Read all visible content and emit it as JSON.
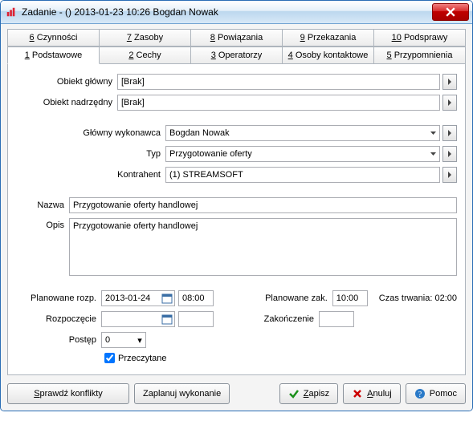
{
  "window": {
    "title": "Zadanie - ()  2013-01-23 10:26  Bogdan Nowak"
  },
  "tabs_top": [
    {
      "key": "6",
      "label": "Czynności"
    },
    {
      "key": "7",
      "label": "Zasoby"
    },
    {
      "key": "8",
      "label": "Powiązania"
    },
    {
      "key": "9",
      "label": "Przekazania"
    },
    {
      "key": "10",
      "label": "Podsprawy"
    }
  ],
  "tabs_bottom": [
    {
      "key": "1",
      "label": "Podstawowe"
    },
    {
      "key": "2",
      "label": "Cechy"
    },
    {
      "key": "3",
      "label": "Operatorzy"
    },
    {
      "key": "4",
      "label": "Osoby kontaktowe"
    },
    {
      "key": "5",
      "label": "Przypomnienia"
    }
  ],
  "labels": {
    "obiekt_glowny": "Obiekt główny",
    "obiekt_nadrzedny": "Obiekt nadrzędny",
    "glowny_wykonawca": "Główny wykonawca",
    "typ": "Typ",
    "kontrahent": "Kontrahent",
    "nazwa": "Nazwa",
    "opis": "Opis",
    "planowane_rozp": "Planowane rozp.",
    "planowane_zak": "Planowane zak.",
    "czas_trwania": "Czas trwania:",
    "rozpoczecie": "Rozpoczęcie",
    "zakonczenie": "Zakończenie",
    "postep": "Postęp",
    "przeczytane": "Przeczytane"
  },
  "values": {
    "obiekt_glowny": "[Brak]",
    "obiekt_nadrzedny": "[Brak]",
    "glowny_wykonawca": "Bogdan Nowak",
    "typ": "Przygotowanie oferty",
    "kontrahent": "(1) STREAMSOFT",
    "nazwa": "Przygotowanie oferty handlowej",
    "opis": "Przygotowanie oferty handlowej",
    "planowane_rozp_date": "2013-01-24",
    "planowane_rozp_time": "08:00",
    "planowane_zak_time": "10:00",
    "czas_trwania_value": "02:00",
    "rozpoczecie_date": "",
    "rozpoczecie_time": "",
    "zakonczenie_time": "",
    "postep": "0",
    "przeczytane": true
  },
  "buttons": {
    "sprawdz_konflikty": "Sprawdź konflikty",
    "zaplanuj_wykonanie": "Zaplanuj wykonanie",
    "zapisz": "Zapisz",
    "anuluj": "Anuluj",
    "pomoc": "Pomoc"
  }
}
